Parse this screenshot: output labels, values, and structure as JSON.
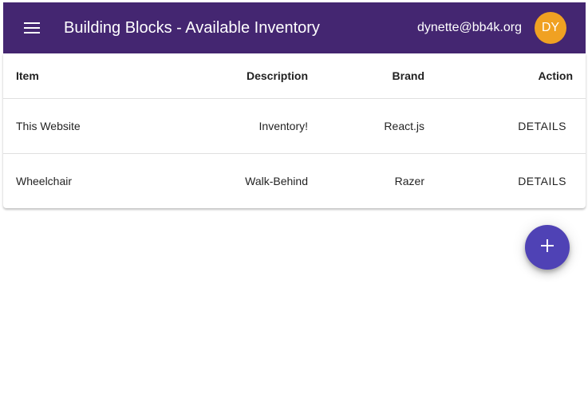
{
  "appbar": {
    "title": "Building Blocks - Available Inventory",
    "menu_icon": "menu-icon",
    "user_email": "dynette@bb4k.org",
    "avatar_initials": "DY",
    "background_color": "#442671",
    "avatar_color": "#f0a122"
  },
  "table": {
    "headers": {
      "item": "Item",
      "description": "Description",
      "brand": "Brand",
      "action": "Action"
    },
    "rows": [
      {
        "item": "This Website",
        "description": "Inventory!",
        "brand": "React.js",
        "action": "DETAILS"
      },
      {
        "item": "Wheelchair",
        "description": "Walk-Behind",
        "brand": "Razer",
        "action": "DETAILS"
      }
    ]
  },
  "fab": {
    "icon": "plus-icon",
    "color": "#4f42b5"
  }
}
